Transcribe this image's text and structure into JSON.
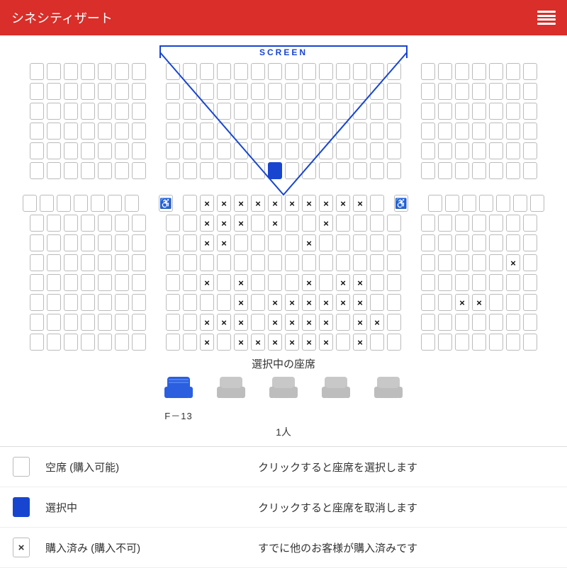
{
  "header": {
    "title": "シネシティザート"
  },
  "screen_label": "SCREEN",
  "selected_seat_label": "F－13",
  "selected_title": "選択中の座席",
  "count_text": "1人",
  "legend": {
    "available": {
      "label": "空席 (購入可能)",
      "desc": "クリックすると座席を選択します"
    },
    "selected": {
      "label": "選択中",
      "desc": "クリックすると座席を取消します"
    },
    "taken": {
      "label": "購入済み (購入不可)",
      "desc": "すでに他のお客様が購入済みです"
    }
  },
  "seat_rows": [
    "ooooooo oooooooooooooo ooooooo",
    "ooooooo oooooooooooooo ooooooo",
    "ooooooo oooooooooooooo ooooooo",
    "ooooooo oooooooooooooo ooooooo",
    "ooooooo oooooooooooooo ooooooo",
    "ooooooo ooooooSooooooo ooooooo",
    "-",
    "ooooooo w.oxxxxxxxxxxo.w ooooooo",
    "ooooooo ooxxxoxooxoooo ooooooo",
    "ooooooo ooxxooooxooooo ooooooo",
    "ooooooo oooooooooooooo oooooxo",
    "ooooooo ooxoxoooxoxxoo ooooooo",
    "ooooooo ooooxoxxxxxxoo ooxxooo",
    "ooooooo ooxxxoxxxxoxxo ooooooo",
    "ooooooo ooxoxxxxxxoxoo ooooooo"
  ]
}
